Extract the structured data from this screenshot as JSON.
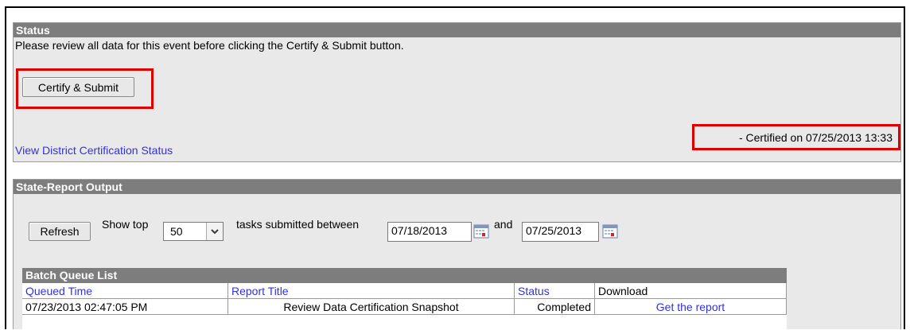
{
  "status_panel": {
    "title": "Status",
    "instruction": "Please review all data for this event before clicking the Certify & Submit button.",
    "certify_button": "Certify & Submit",
    "certified_text": "- Certified on 07/25/2013 13:33",
    "district_link": "View District Certification Status"
  },
  "output_panel": {
    "title": "State-Report Output",
    "refresh_button": "Refresh",
    "show_top_label": "Show top",
    "show_top_value": "50",
    "tasks_label": "tasks submitted between",
    "start_date": "07/18/2013",
    "and_label": "and",
    "end_date": "07/25/2013"
  },
  "batch_queue": {
    "title": "Batch Queue List",
    "columns": [
      "Queued Time",
      "Report Title",
      "Status",
      "Download"
    ],
    "rows": [
      {
        "queued_time": "07/23/2013 02:47:05 PM",
        "report_title": "Review Data Certification Snapshot",
        "status": "Completed",
        "download": "Get the report"
      }
    ]
  },
  "colors": {
    "highlight": "#e00000",
    "header_bg": "#7d7d7d",
    "link": "#3232d8",
    "panel_bg": "#e9e9e9"
  }
}
